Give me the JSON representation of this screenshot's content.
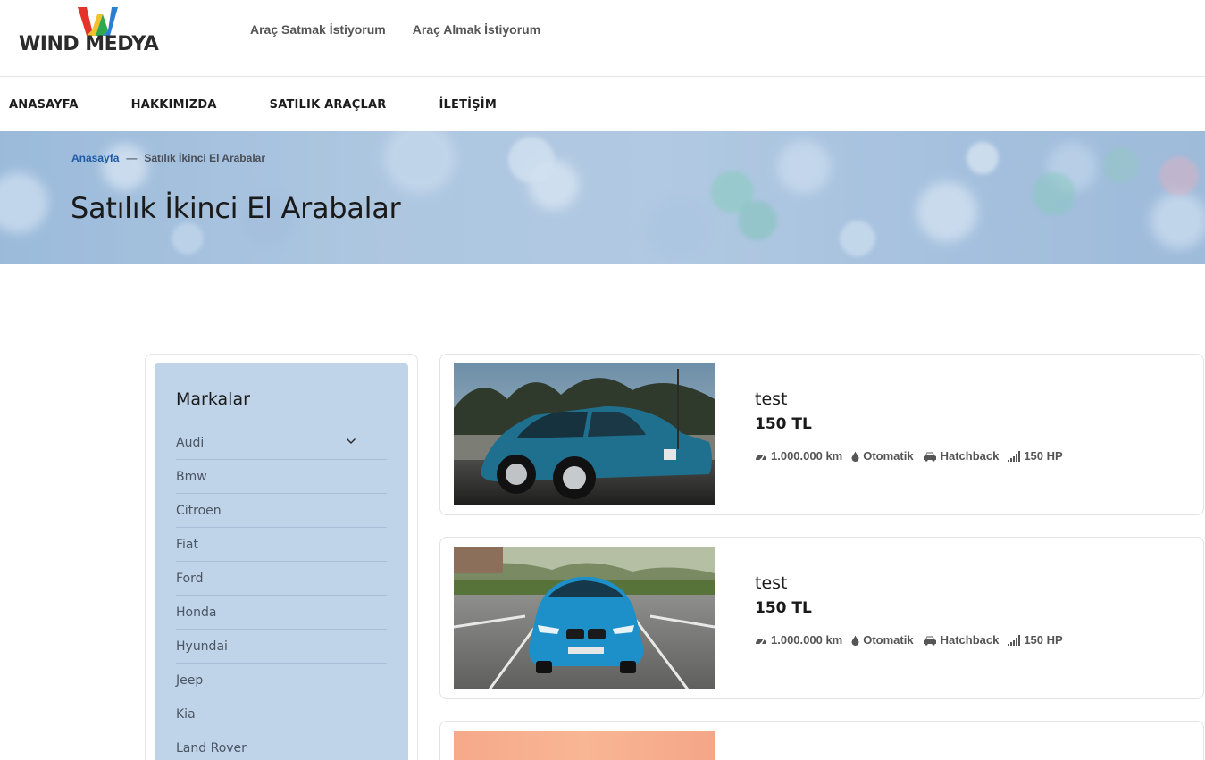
{
  "header": {
    "logo_text": "WIND MEDYA",
    "links": [
      {
        "label": "Araç Satmak İstiyorum"
      },
      {
        "label": "Araç Almak İstiyorum"
      }
    ]
  },
  "nav": {
    "items": [
      {
        "label": "ANASAYFA"
      },
      {
        "label": "HAKKIMIZDA"
      },
      {
        "label": "SATILIK ARAÇLAR"
      },
      {
        "label": "İLETİŞİM"
      }
    ]
  },
  "hero": {
    "breadcrumb": {
      "home": "Anasayfa",
      "separator": "—",
      "current": "Satılık İkinci El Arabalar"
    },
    "title": "Satılık İkinci El Arabalar"
  },
  "sidebar": {
    "title": "Markalar",
    "brands": [
      {
        "label": "Audi"
      },
      {
        "label": "Bmw"
      },
      {
        "label": "Citroen"
      },
      {
        "label": "Fiat"
      },
      {
        "label": "Ford"
      },
      {
        "label": "Honda"
      },
      {
        "label": "Hyundai"
      },
      {
        "label": "Jeep"
      },
      {
        "label": "Kia"
      },
      {
        "label": "Land Rover"
      }
    ]
  },
  "listings": [
    {
      "title": "test",
      "price": "150 TL",
      "km": "1.000.000 km",
      "transmission": "Otomatik",
      "body": "Hatchback",
      "power": "150 HP",
      "car_color": "#1f6f8f"
    },
    {
      "title": "test",
      "price": "150 TL",
      "km": "1.000.000 km",
      "transmission": "Otomatik",
      "body": "Hatchback",
      "power": "150 HP",
      "car_color": "#1d90c9"
    }
  ],
  "icons": {
    "speedometer": "speedometer-icon",
    "transmission": "fuel-drop-icon",
    "body": "car-icon",
    "power": "signal-bars-icon",
    "dropdown": "chevron-down-icon"
  }
}
